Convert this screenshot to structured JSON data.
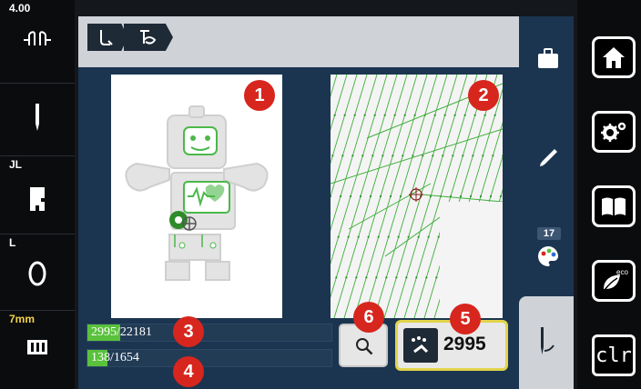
{
  "left_status": {
    "tension_value": "4.00",
    "foot_label": "JL",
    "thread_label": "L",
    "width_value": "7mm"
  },
  "breadcrumb": {
    "items": [
      "embroidery-needle-icon",
      "stitch-pattern-icon"
    ]
  },
  "callouts": [
    "1",
    "2",
    "3",
    "4",
    "5",
    "6"
  ],
  "progress": {
    "total_stitches_text": "2995/22181",
    "total_stitches_fraction": 0.135,
    "color_stitches_text": "138/1654",
    "color_stitches_fraction": 0.083
  },
  "stitch_counter": {
    "value": "2995"
  },
  "sub_column": {
    "color_count": "17"
  },
  "right_nav": {
    "clr_label": "clr"
  },
  "colors": {
    "accent_green": "#59c13b",
    "callout_red": "#d7261e",
    "highlight_yellow": "#e2d44a",
    "panel_blue": "#1b3550"
  }
}
